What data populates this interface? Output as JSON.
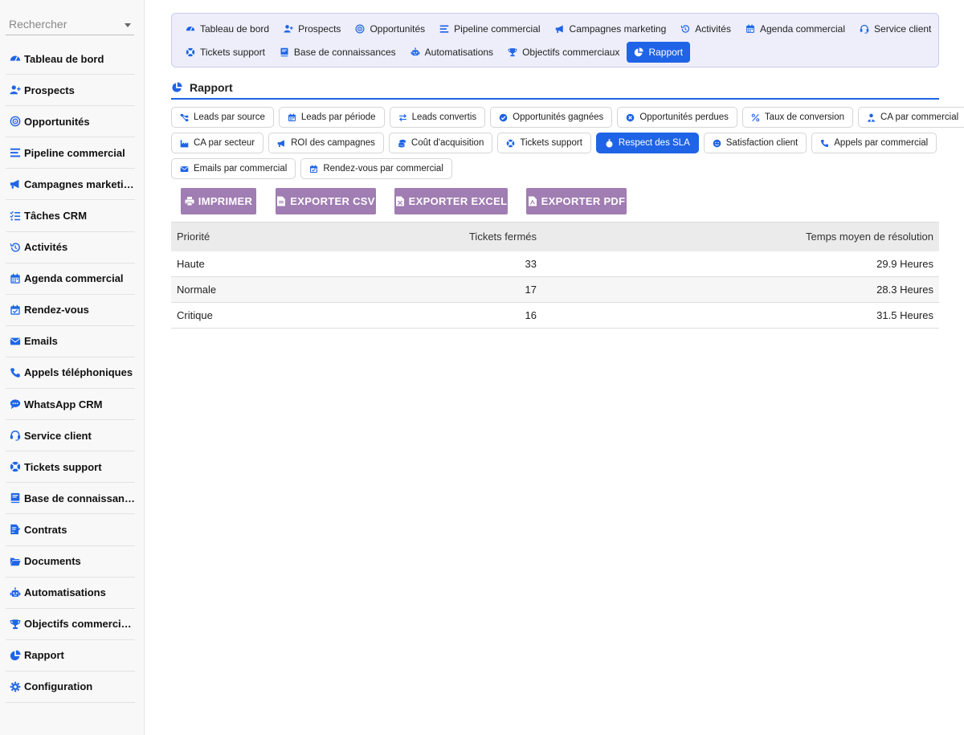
{
  "search": {
    "placeholder": "Rechercher"
  },
  "colors": {
    "accent": "#1f64e6",
    "button": "#a07db2",
    "nav_bg": "#eeeefb"
  },
  "sidebar": {
    "items": [
      {
        "label": "Tableau de bord",
        "icon": "dashboard-icon"
      },
      {
        "label": "Prospects",
        "icon": "user-plus-icon"
      },
      {
        "label": "Opportunités",
        "icon": "target-icon"
      },
      {
        "label": "Pipeline commercial",
        "icon": "bars-icon"
      },
      {
        "label": "Campagnes marketing",
        "icon": "megaphone-icon"
      },
      {
        "label": "Tâches CRM",
        "icon": "task-list-icon"
      },
      {
        "label": "Activités",
        "icon": "history-icon"
      },
      {
        "label": "Agenda commercial",
        "icon": "calendar-icon"
      },
      {
        "label": "Rendez-vous",
        "icon": "calendar-check-icon"
      },
      {
        "label": "Emails",
        "icon": "envelope-icon"
      },
      {
        "label": "Appels téléphoniques",
        "icon": "phone-icon"
      },
      {
        "label": "WhatsApp CRM",
        "icon": "chat-icon"
      },
      {
        "label": "Service client",
        "icon": "headset-icon"
      },
      {
        "label": "Tickets support",
        "icon": "lifebuoy-icon"
      },
      {
        "label": "Base de connaissan…",
        "icon": "book-icon"
      },
      {
        "label": "Contrats",
        "icon": "contract-icon"
      },
      {
        "label": "Documents",
        "icon": "folder-icon"
      },
      {
        "label": "Automatisations",
        "icon": "robot-icon"
      },
      {
        "label": "Objectifs commerciaux",
        "icon": "trophy-icon"
      },
      {
        "label": "Rapport",
        "icon": "pie-chart-icon"
      },
      {
        "label": "Configuration",
        "icon": "gear-icon"
      }
    ]
  },
  "topnav": {
    "row1": [
      {
        "label": "Tableau de bord",
        "icon": "dashboard-icon"
      },
      {
        "label": "Prospects",
        "icon": "user-plus-icon"
      },
      {
        "label": "Opportunités",
        "icon": "target-icon"
      },
      {
        "label": "Pipeline commercial",
        "icon": "bars-icon"
      },
      {
        "label": "Campagnes marketing",
        "icon": "megaphone-icon"
      },
      {
        "label": "Activités",
        "icon": "history-icon"
      },
      {
        "label": "Agenda commercial",
        "icon": "calendar-icon"
      },
      {
        "label": "Service client",
        "icon": "headset-icon"
      }
    ],
    "row2": [
      {
        "label": "Tickets support",
        "icon": "lifebuoy-icon"
      },
      {
        "label": "Base de connaissances",
        "icon": "book-icon"
      },
      {
        "label": "Automatisations",
        "icon": "robot-icon"
      },
      {
        "label": "Objectifs commerciaux",
        "icon": "trophy-icon"
      },
      {
        "label": "Rapport",
        "icon": "pie-chart-icon",
        "active": true
      }
    ]
  },
  "section": {
    "title": "Rapport"
  },
  "reports": {
    "row1": [
      {
        "label": "Leads par source",
        "icon": "sitemap-icon"
      },
      {
        "label": "Leads par période",
        "icon": "calendar-icon"
      },
      {
        "label": "Leads convertis",
        "icon": "exchange-icon"
      },
      {
        "label": "Opportunités gagnées",
        "icon": "check-circle-icon"
      },
      {
        "label": "Opportunités perdues",
        "icon": "x-circle-icon"
      },
      {
        "label": "Taux de conversion",
        "icon": "percent-icon"
      },
      {
        "label": "CA par commercial",
        "icon": "user-tie-icon"
      }
    ],
    "row2": [
      {
        "label": "CA par secteur",
        "icon": "industry-icon"
      },
      {
        "label": "ROI des campagnes",
        "icon": "megaphone-icon"
      },
      {
        "label": "Coût d'acquisition",
        "icon": "coins-icon"
      },
      {
        "label": "Tickets support",
        "icon": "lifebuoy-icon"
      },
      {
        "label": "Respect des SLA",
        "icon": "stopwatch-icon",
        "active": true
      },
      {
        "label": "Satisfaction client",
        "icon": "smile-icon"
      },
      {
        "label": "Appels par commercial",
        "icon": "phone-icon"
      }
    ],
    "row3": [
      {
        "label": "Emails par commercial",
        "icon": "envelope-icon"
      },
      {
        "label": "Rendez-vous par commercial",
        "icon": "calendar-check-icon"
      }
    ]
  },
  "actions": {
    "print": "IMPRIMER",
    "csv": "EXPORTER CSV",
    "excel": "EXPORTER EXCEL",
    "pdf": "EXPORTER PDF"
  },
  "table": {
    "headers": [
      "Priorité",
      "Tickets fermés",
      "Temps moyen de résolution"
    ],
    "rows": [
      [
        "Haute",
        "33",
        "29.9 Heures"
      ],
      [
        "Normale",
        "17",
        "28.3 Heures"
      ],
      [
        "Critique",
        "16",
        "31.5 Heures"
      ]
    ]
  }
}
